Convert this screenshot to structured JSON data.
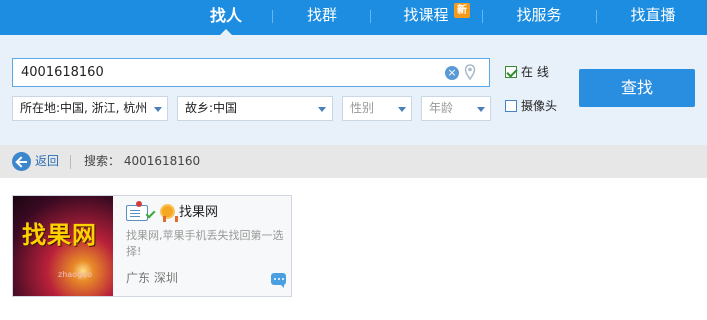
{
  "nav": {
    "tabs": [
      {
        "label": "找人",
        "active": true
      },
      {
        "label": "找群",
        "active": false
      },
      {
        "label": "找课程",
        "active": false,
        "badge": "新"
      },
      {
        "label": "找服务",
        "active": false
      },
      {
        "label": "找直播",
        "active": false
      }
    ]
  },
  "search": {
    "query": "4001618160",
    "online_label": "在  线",
    "online_checked": true,
    "camera_label": "摄像头",
    "camera_checked": false,
    "find_label": "查找"
  },
  "filters": {
    "location": "所在地:中国, 浙江, 杭州",
    "hometown": "故乡:中国",
    "gender": "性别",
    "age": "年龄"
  },
  "breadcrumb": {
    "back_label": "返回",
    "summary_label": "搜索：",
    "summary_query": "4001618160"
  },
  "results": [
    {
      "thumb_text": "找果网",
      "thumb_sub": "zhaoguo",
      "name": "找果网",
      "description": "找果网,苹果手机丢失找回第一选择!",
      "location": "广东 深圳"
    }
  ],
  "colors": {
    "nav_bg": "#1c8de0",
    "button_bg": "#2a8ee0",
    "badge": "#f59a1b",
    "panel_bg": "#e8f0f9"
  }
}
